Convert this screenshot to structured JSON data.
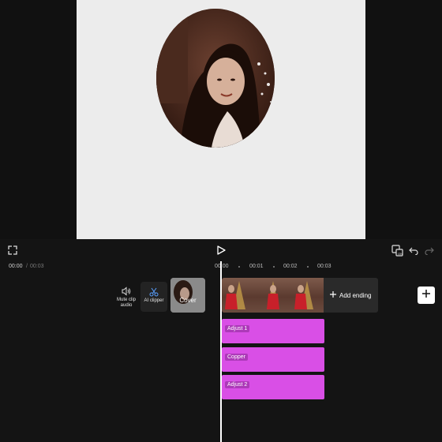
{
  "preview": {
    "playback": {
      "current_time": "00:00",
      "separator": "/",
      "total_time": "00:03"
    }
  },
  "ruler": {
    "ticks": [
      "00:00",
      "00:01",
      "00:02",
      "00:03"
    ]
  },
  "tools": {
    "mute_label": "Mute clip audio",
    "ai_clipper_label": "AI clipper",
    "cover_label": "Cover"
  },
  "video_track": {
    "add_ending_label": "Add ending"
  },
  "effects": [
    {
      "label": "Adjust 1"
    },
    {
      "label": "Copper"
    },
    {
      "label": "Adjust 2"
    }
  ],
  "colors": {
    "effect_track": "#d94fe6",
    "canvas": "#ececec",
    "background": "#141414",
    "playhead": "#ffffff"
  },
  "icons": {
    "fullscreen": "fullscreen-icon",
    "play": "play-icon",
    "keyframe": "keyframe-toggle-icon",
    "undo": "undo-icon",
    "redo": "redo-icon",
    "mute": "speaker-icon",
    "ai_clipper": "scissors-icon",
    "add_ending": "plus-icon",
    "add_clip": "plus-icon"
  }
}
